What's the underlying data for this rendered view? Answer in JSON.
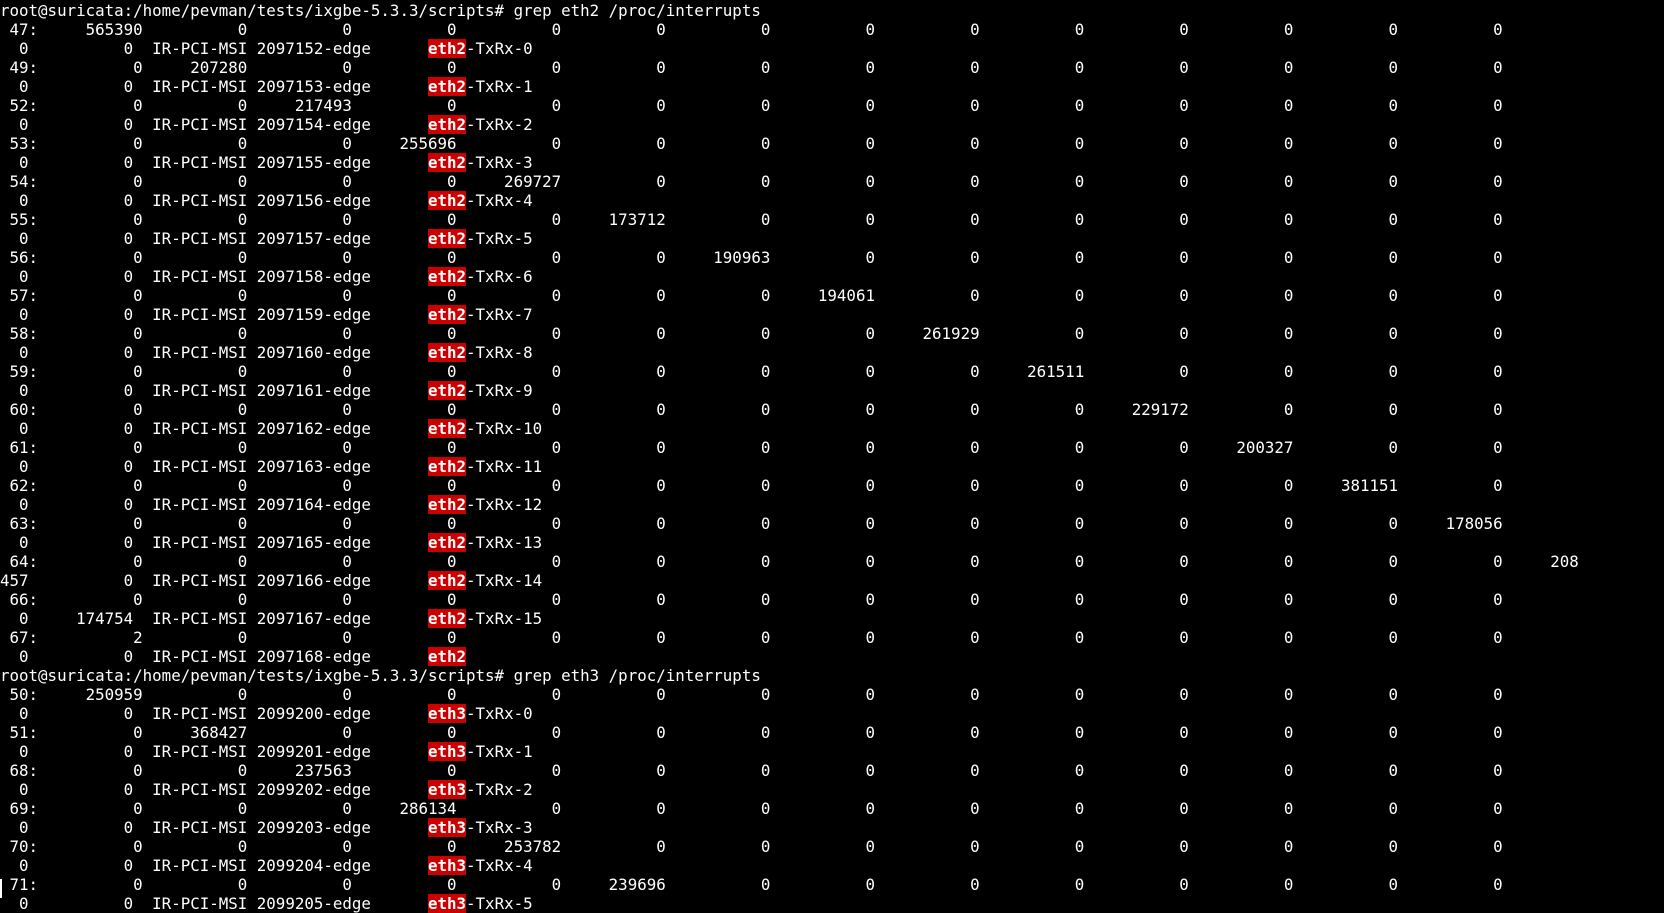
{
  "terminal": {
    "lines": [
      {
        "pre": "root@suricata:/home/pevman/tests/ixgbe-5.3.3/scripts# grep eth2 /proc/interrupts",
        "hl": "",
        "post": ""
      },
      {
        "pre": " 47:     565390          0          0          0          0          0          0          0          0          0          0          0          0          0",
        "hl": "",
        "post": ""
      },
      {
        "pre": "  0          0  IR-PCI-MSI 2097152-edge      ",
        "hl": "eth2",
        "post": "-TxRx-0"
      },
      {
        "pre": " 49:          0     207280          0          0          0          0          0          0          0          0          0          0          0          0",
        "hl": "",
        "post": ""
      },
      {
        "pre": "  0          0  IR-PCI-MSI 2097153-edge      ",
        "hl": "eth2",
        "post": "-TxRx-1"
      },
      {
        "pre": " 52:          0          0     217493          0          0          0          0          0          0          0          0          0          0          0",
        "hl": "",
        "post": ""
      },
      {
        "pre": "  0          0  IR-PCI-MSI 2097154-edge      ",
        "hl": "eth2",
        "post": "-TxRx-2"
      },
      {
        "pre": " 53:          0          0          0     255696          0          0          0          0          0          0          0          0          0          0",
        "hl": "",
        "post": ""
      },
      {
        "pre": "  0          0  IR-PCI-MSI 2097155-edge      ",
        "hl": "eth2",
        "post": "-TxRx-3"
      },
      {
        "pre": " 54:          0          0          0          0     269727          0          0          0          0          0          0          0          0          0",
        "hl": "",
        "post": ""
      },
      {
        "pre": "  0          0  IR-PCI-MSI 2097156-edge      ",
        "hl": "eth2",
        "post": "-TxRx-4"
      },
      {
        "pre": " 55:          0          0          0          0          0     173712          0          0          0          0          0          0          0          0",
        "hl": "",
        "post": ""
      },
      {
        "pre": "  0          0  IR-PCI-MSI 2097157-edge      ",
        "hl": "eth2",
        "post": "-TxRx-5"
      },
      {
        "pre": " 56:          0          0          0          0          0          0     190963          0          0          0          0          0          0          0",
        "hl": "",
        "post": ""
      },
      {
        "pre": "  0          0  IR-PCI-MSI 2097158-edge      ",
        "hl": "eth2",
        "post": "-TxRx-6"
      },
      {
        "pre": " 57:          0          0          0          0          0          0          0     194061          0          0          0          0          0          0",
        "hl": "",
        "post": ""
      },
      {
        "pre": "  0          0  IR-PCI-MSI 2097159-edge      ",
        "hl": "eth2",
        "post": "-TxRx-7"
      },
      {
        "pre": " 58:          0          0          0          0          0          0          0          0     261929          0          0          0          0          0",
        "hl": "",
        "post": ""
      },
      {
        "pre": "  0          0  IR-PCI-MSI 2097160-edge      ",
        "hl": "eth2",
        "post": "-TxRx-8"
      },
      {
        "pre": " 59:          0          0          0          0          0          0          0          0          0     261511          0          0          0          0",
        "hl": "",
        "post": ""
      },
      {
        "pre": "  0          0  IR-PCI-MSI 2097161-edge      ",
        "hl": "eth2",
        "post": "-TxRx-9"
      },
      {
        "pre": " 60:          0          0          0          0          0          0          0          0          0          0     229172          0          0          0",
        "hl": "",
        "post": ""
      },
      {
        "pre": "  0          0  IR-PCI-MSI 2097162-edge      ",
        "hl": "eth2",
        "post": "-TxRx-10"
      },
      {
        "pre": " 61:          0          0          0          0          0          0          0          0          0          0          0     200327          0          0",
        "hl": "",
        "post": ""
      },
      {
        "pre": "  0          0  IR-PCI-MSI 2097163-edge      ",
        "hl": "eth2",
        "post": "-TxRx-11"
      },
      {
        "pre": " 62:          0          0          0          0          0          0          0          0          0          0          0          0     381151          0",
        "hl": "",
        "post": ""
      },
      {
        "pre": "  0          0  IR-PCI-MSI 2097164-edge      ",
        "hl": "eth2",
        "post": "-TxRx-12"
      },
      {
        "pre": " 63:          0          0          0          0          0          0          0          0          0          0          0          0          0     178056",
        "hl": "",
        "post": ""
      },
      {
        "pre": "  0          0  IR-PCI-MSI 2097165-edge      ",
        "hl": "eth2",
        "post": "-TxRx-13"
      },
      {
        "pre": " 64:          0          0          0          0          0          0          0          0          0          0          0          0          0          0     208",
        "hl": "",
        "post": ""
      },
      {
        "pre": "457          0  IR-PCI-MSI 2097166-edge      ",
        "hl": "eth2",
        "post": "-TxRx-14"
      },
      {
        "pre": " 66:          0          0          0          0          0          0          0          0          0          0          0          0          0          0",
        "hl": "",
        "post": ""
      },
      {
        "pre": "  0     174754  IR-PCI-MSI 2097167-edge      ",
        "hl": "eth2",
        "post": "-TxRx-15"
      },
      {
        "pre": " 67:          2          0          0          0          0          0          0          0          0          0          0          0          0          0",
        "hl": "",
        "post": ""
      },
      {
        "pre": "  0          0  IR-PCI-MSI 2097168-edge      ",
        "hl": "eth2",
        "post": ""
      },
      {
        "pre": "root@suricata:/home/pevman/tests/ixgbe-5.3.3/scripts# grep eth3 /proc/interrupts",
        "hl": "",
        "post": ""
      },
      {
        "pre": " 50:     250959          0          0          0          0          0          0          0          0          0          0          0          0          0",
        "hl": "",
        "post": ""
      },
      {
        "pre": "  0          0  IR-PCI-MSI 2099200-edge      ",
        "hl": "eth3",
        "post": "-TxRx-0"
      },
      {
        "pre": " 51:          0     368427          0          0          0          0          0          0          0          0          0          0          0          0",
        "hl": "",
        "post": ""
      },
      {
        "pre": "  0          0  IR-PCI-MSI 2099201-edge      ",
        "hl": "eth3",
        "post": "-TxRx-1"
      },
      {
        "pre": " 68:          0          0     237563          0          0          0          0          0          0          0          0          0          0          0",
        "hl": "",
        "post": ""
      },
      {
        "pre": "  0          0  IR-PCI-MSI 2099202-edge      ",
        "hl": "eth3",
        "post": "-TxRx-2"
      },
      {
        "pre": " 69:          0          0          0     286134          0          0          0          0          0          0          0          0          0          0",
        "hl": "",
        "post": ""
      },
      {
        "pre": "  0          0  IR-PCI-MSI 2099203-edge      ",
        "hl": "eth3",
        "post": "-TxRx-3"
      },
      {
        "pre": " 70:          0          0          0          0     253782          0          0          0          0          0          0          0          0          0",
        "hl": "",
        "post": ""
      },
      {
        "pre": "  0          0  IR-PCI-MSI 2099204-edge      ",
        "hl": "eth3",
        "post": "-TxRx-4"
      },
      {
        "pre": " 71:          0          0          0          0          0     239696          0          0          0          0          0          0          0          0",
        "hl": "",
        "post": ""
      },
      {
        "pre": "  0          0  IR-PCI-MSI 2099205-edge      ",
        "hl": "eth3",
        "post": "-TxRx-5"
      }
    ]
  }
}
